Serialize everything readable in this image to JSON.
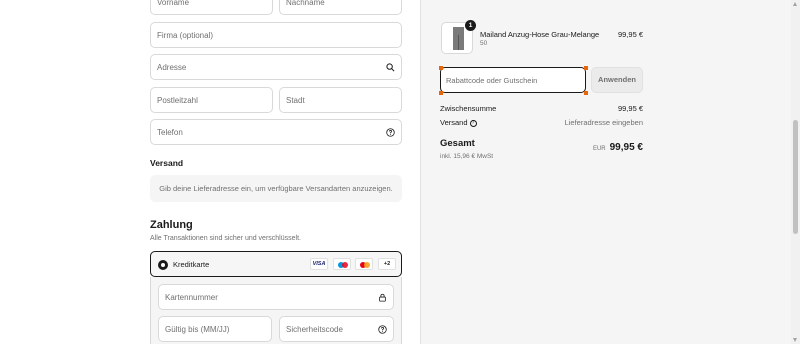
{
  "form": {
    "first_name_placeholder": "Vorname",
    "last_name_placeholder": "Nachname",
    "company_placeholder": "Firma (optional)",
    "address_placeholder": "Adresse",
    "postal_code_placeholder": "Postleitzahl",
    "city_placeholder": "Stadt",
    "phone_placeholder": "Telefon"
  },
  "shipping": {
    "heading": "Versand",
    "info": "Gib deine Lieferadresse ein, um verfügbare Versandarten anzuzeigen."
  },
  "payment": {
    "heading": "Zahlung",
    "subtitle": "Alle Transaktionen sind sicher und verschlüsselt.",
    "method_label": "Kreditkarte",
    "card_visa": "VISA",
    "card_more": "+2",
    "card_number_placeholder": "Kartennummer",
    "expiry_placeholder": "Gültig bis (MM/JJ)",
    "cvc_placeholder": "Sicherheitscode"
  },
  "summary": {
    "product": {
      "quantity": "1",
      "name": "Mailand Anzug-Hose Grau-Melange",
      "variant": "50",
      "price": "99,95 €"
    },
    "discount_placeholder": "Rabattcode oder Gutschein",
    "apply_label": "Anwenden",
    "subtotal_label": "Zwischensumme",
    "subtotal_value": "99,95 €",
    "shipping_label": "Versand",
    "shipping_help": "?",
    "shipping_value": "Lieferadresse eingeben",
    "total_label": "Gesamt",
    "total_currency": "EUR",
    "total_value": "99,95 €",
    "tax_note": "inkl. 15,96 € MwSt"
  },
  "icons": {
    "address": "search-icon",
    "phone": "help-circle-icon",
    "card_number": "lock-icon",
    "cvc": "help-circle-icon",
    "shipping_help": "help-circle-icon"
  },
  "colors": {
    "accent": "#1a1a1a",
    "muted_text": "#707070",
    "border": "#d9d9d9",
    "summary_bg": "#f5f5f5",
    "selection_handle": "#e8650a",
    "mastercard_red": "#eb001b",
    "mastercard_orange": "#f79e1b",
    "maestro_blue": "#0099df",
    "visa_blue": "#1a1f71"
  }
}
